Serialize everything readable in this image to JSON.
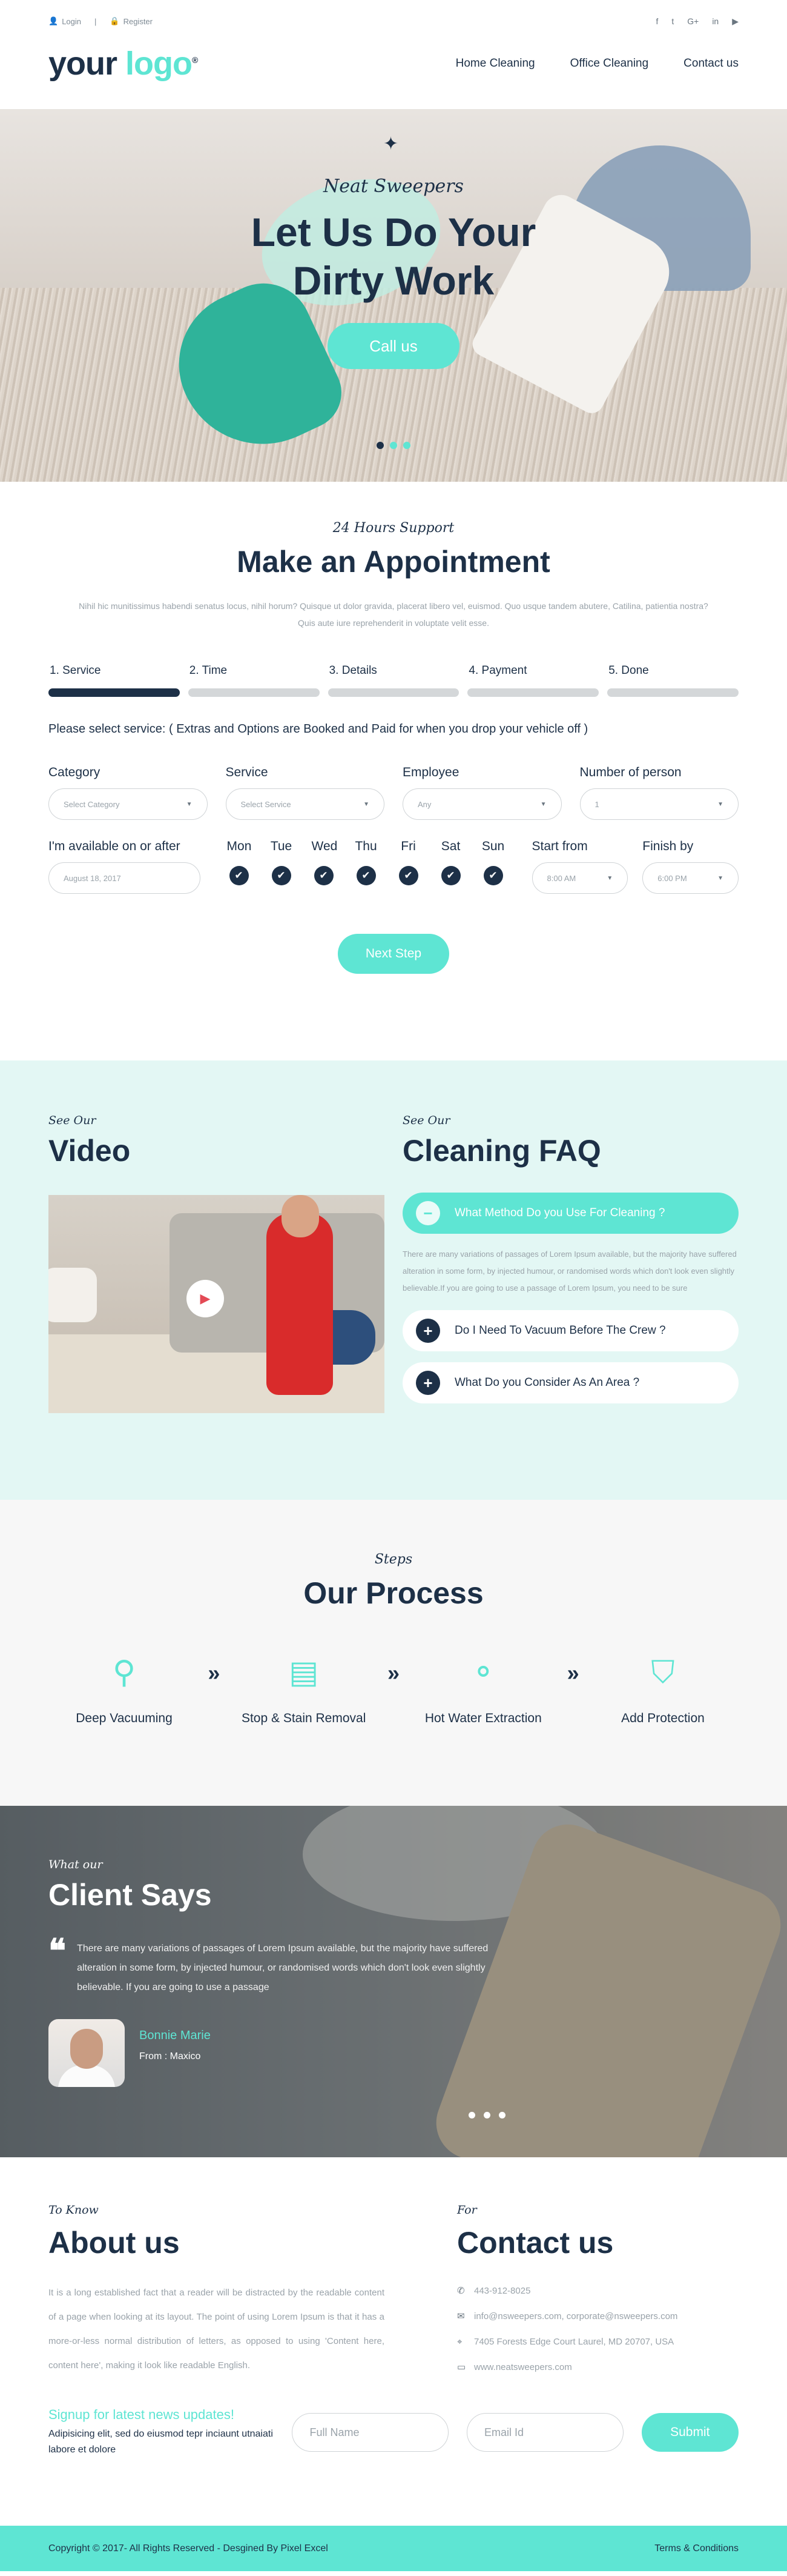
{
  "topbar": {
    "login": "Login",
    "register": "Register",
    "social": [
      "f",
      "t",
      "G+",
      "in",
      "yt"
    ]
  },
  "header": {
    "logo_a": "your ",
    "logo_b": "logo",
    "logo_r": "®",
    "nav": [
      "Home Cleaning",
      "Office Cleaning",
      "Contact us"
    ]
  },
  "hero": {
    "kicker": "Neat Sweepers",
    "title1": "Let Us Do Your",
    "title2": "Dirty Work",
    "cta": "Call us"
  },
  "appointment": {
    "kicker": "24 Hours Support",
    "title": "Make an Appointment",
    "intro": "Nihil hic munitissimus habendi senatus locus, nihil horum? Quisque ut dolor gravida, placerat libero vel, euismod. Quo usque tandem abutere, Catilina, patientia nostra? Quis aute iure reprehenderit in voluptate velit esse.",
    "steps": [
      "1. Service",
      "2. Time",
      "3. Details",
      "4. Payment",
      "5. Done"
    ],
    "note": "Please select service: ( Extras and Options are Booked and Paid for when you drop your vehicle off )",
    "fields": [
      {
        "label": "Category",
        "value": "Select Category"
      },
      {
        "label": "Service",
        "value": "Select Service"
      },
      {
        "label": "Employee",
        "value": "Any"
      },
      {
        "label": "Number of person",
        "value": "1"
      }
    ],
    "avail_label": "I'm available on or after",
    "avail_value": "August 18, 2017",
    "days": [
      "Mon",
      "Tue",
      "Wed",
      "Thu",
      "Fri",
      "Sat",
      "Sun"
    ],
    "start_label": "Start from",
    "start_value": "8:00 AM",
    "finish_label": "Finish by",
    "finish_value": "6:00 PM",
    "next": "Next Step"
  },
  "video": {
    "kicker": "See Our",
    "title": "Video"
  },
  "faq": {
    "kicker": "See Our",
    "title": "Cleaning FAQ",
    "items": [
      "What Method Do you Use For Cleaning ?",
      "Do I Need To Vacuum Before The Crew ?",
      "What Do you Consider As An Area ?"
    ],
    "answer": "There are many variations of passages of Lorem Ipsum available, but the majority have suffered alteration in some form, by injected humour, or randomised words which don't look even slightly believable.If you are going to use a passage of Lorem Ipsum, you need to be sure"
  },
  "process": {
    "kicker": "Steps",
    "title": "Our Process",
    "items": [
      "Deep Vacuuming",
      "Stop & Stain Removal",
      "Hot Water Extraction",
      "Add Protection"
    ]
  },
  "testimonial": {
    "kicker": "What our",
    "title": "Client Says",
    "quote": "There are many variations of passages of Lorem Ipsum available, but the majority have suffered alteration in some form, by injected humour, or randomised words which don't look even slightly believable. If you are going to use a passage",
    "name": "Bonnie Marie",
    "from": "From : Maxico"
  },
  "about": {
    "kicker": "To Know",
    "title": "About us",
    "text": "It is a long established fact that a reader will be distracted by the readable content of a page when looking at its layout. The point of using Lorem Ipsum is that it has a more-or-less normal distribution of letters, as opposed to using 'Content here, content here', making it look like readable English."
  },
  "contact": {
    "kicker": "For",
    "title": "Contact us",
    "phone": "443-912-8025",
    "email": "info@nsweepers.com, corporate@nsweepers.com",
    "address": "7405 Forests Edge Court Laurel, MD 20707, USA",
    "web": "www.neatsweepers.com"
  },
  "newsletter": {
    "title": "Signup for latest news updates!",
    "text": "Adipisicing elit, sed do eiusmod tepr inciaunt utnaiati labore et dolore",
    "name_ph": "Full Name",
    "email_ph": "Email Id",
    "submit": "Submit"
  },
  "footer": {
    "copy": "Copyright © 2017- All Rights Reserved - Desgined By Pixel Excel",
    "terms": "Terms & Conditions"
  },
  "colors": {
    "accent": "#5ee5d3",
    "navy": "#1d3047",
    "mint_bg": "#e3f7f4"
  }
}
